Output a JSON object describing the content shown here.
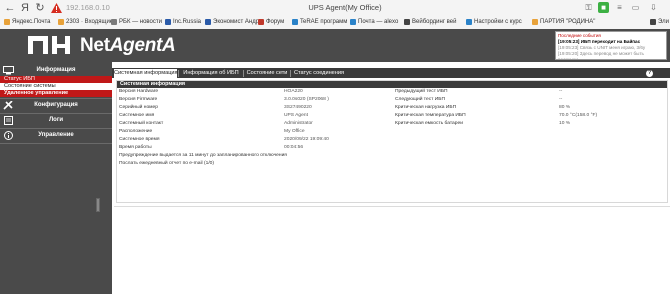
{
  "browser": {
    "url": "192.168.0.10",
    "window_title": "UPS Agent(My Office)",
    "bookmarks": [
      {
        "label": "Яндекс.Почта",
        "color": "#e8a23a"
      },
      {
        "label": "2303 · Входящие",
        "color": "#e8a23a"
      },
      {
        "label": "РБК — новости",
        "color": "#7a7a7a"
      },
      {
        "label": "Inc.Russia",
        "color": "#2a5aa8"
      },
      {
        "label": "Экономист Андр",
        "color": "#2a5aa8"
      },
      {
        "label": "Форум",
        "color": "#c0392b"
      },
      {
        "label": "TeRAE программ",
        "color": "#2a82c8"
      },
      {
        "label": "Почта — alexo",
        "color": "#2a82c8"
      },
      {
        "label": "Вейбординг вей",
        "color": "#444"
      },
      {
        "label": "Настройки с курс",
        "color": "#2a82c8"
      },
      {
        "label": "ПАРТИЯ \"РОДИНА\"",
        "color": "#e8a23a"
      },
      {
        "label": "Эли",
        "color": "#444"
      }
    ]
  },
  "header": {
    "logo_prefix": "Net",
    "logo_suffix": "AgentA",
    "events": {
      "title": "Последние события",
      "main": "[19:05:23] ИБП переходит на Байпас",
      "line2": "[19:05:23] Связь с UNIT меня играю, 3/6у",
      "line3": "[19:05:20] Здесь перевод не может быть редакции"
    }
  },
  "sidebar": {
    "info_label": "Информация",
    "items": [
      "Статус ИБП",
      "Состояние системы",
      "Удаленное управление"
    ],
    "config_label": "Конфигурация",
    "logs_label": "Логи",
    "control_label": "Управление"
  },
  "tabs": [
    {
      "label": "Системная информация",
      "active": true
    },
    {
      "label": "Информация об ИБП",
      "active": false
    },
    {
      "label": "Состояние сети",
      "active": false
    },
    {
      "label": "Статус соединения",
      "active": false
    }
  ],
  "panel": {
    "title": "Системная информация",
    "left_rows": [
      {
        "label": "Версия Hardware",
        "value": "HOA220"
      },
      {
        "label": "Версия Firmware",
        "value": "3.0.0s020 (SP2068 )"
      },
      {
        "label": "Серийный номер",
        "value": "3S27490220"
      },
      {
        "label": "Системное имя",
        "value": "UPS Agent"
      },
      {
        "label": "Системный контакт",
        "value": "Administrator"
      },
      {
        "label": "Расположение",
        "value": "My Office"
      },
      {
        "label": "Системное время",
        "value": "2020/09/22 19:09:40"
      },
      {
        "label": "Время работы",
        "value": "00:04:56"
      }
    ],
    "note": "Предупреждение выдается за 11 минут до запланированного отключения",
    "note2": "Послать ежедневный отчет по e-mail (1/0)",
    "right_rows": [
      {
        "label": "Предыдущий тест ИБП",
        "value": "--"
      },
      {
        "label": "Следующий тест ИБП",
        "value": "--"
      },
      {
        "label": "Критическая нагрузка ИБП",
        "value": "80 %"
      },
      {
        "label": "Критическая температура ИБП",
        "value": "70.0 °C(158.0 °F)"
      },
      {
        "label": "Критическая емкость батареи",
        "value": "10 %"
      }
    ]
  },
  "colors": {
    "header_bg": "#4a4a4a",
    "accent_red": "#c01818",
    "tab_bar": "#3b3b3b"
  },
  "help_label": "?"
}
